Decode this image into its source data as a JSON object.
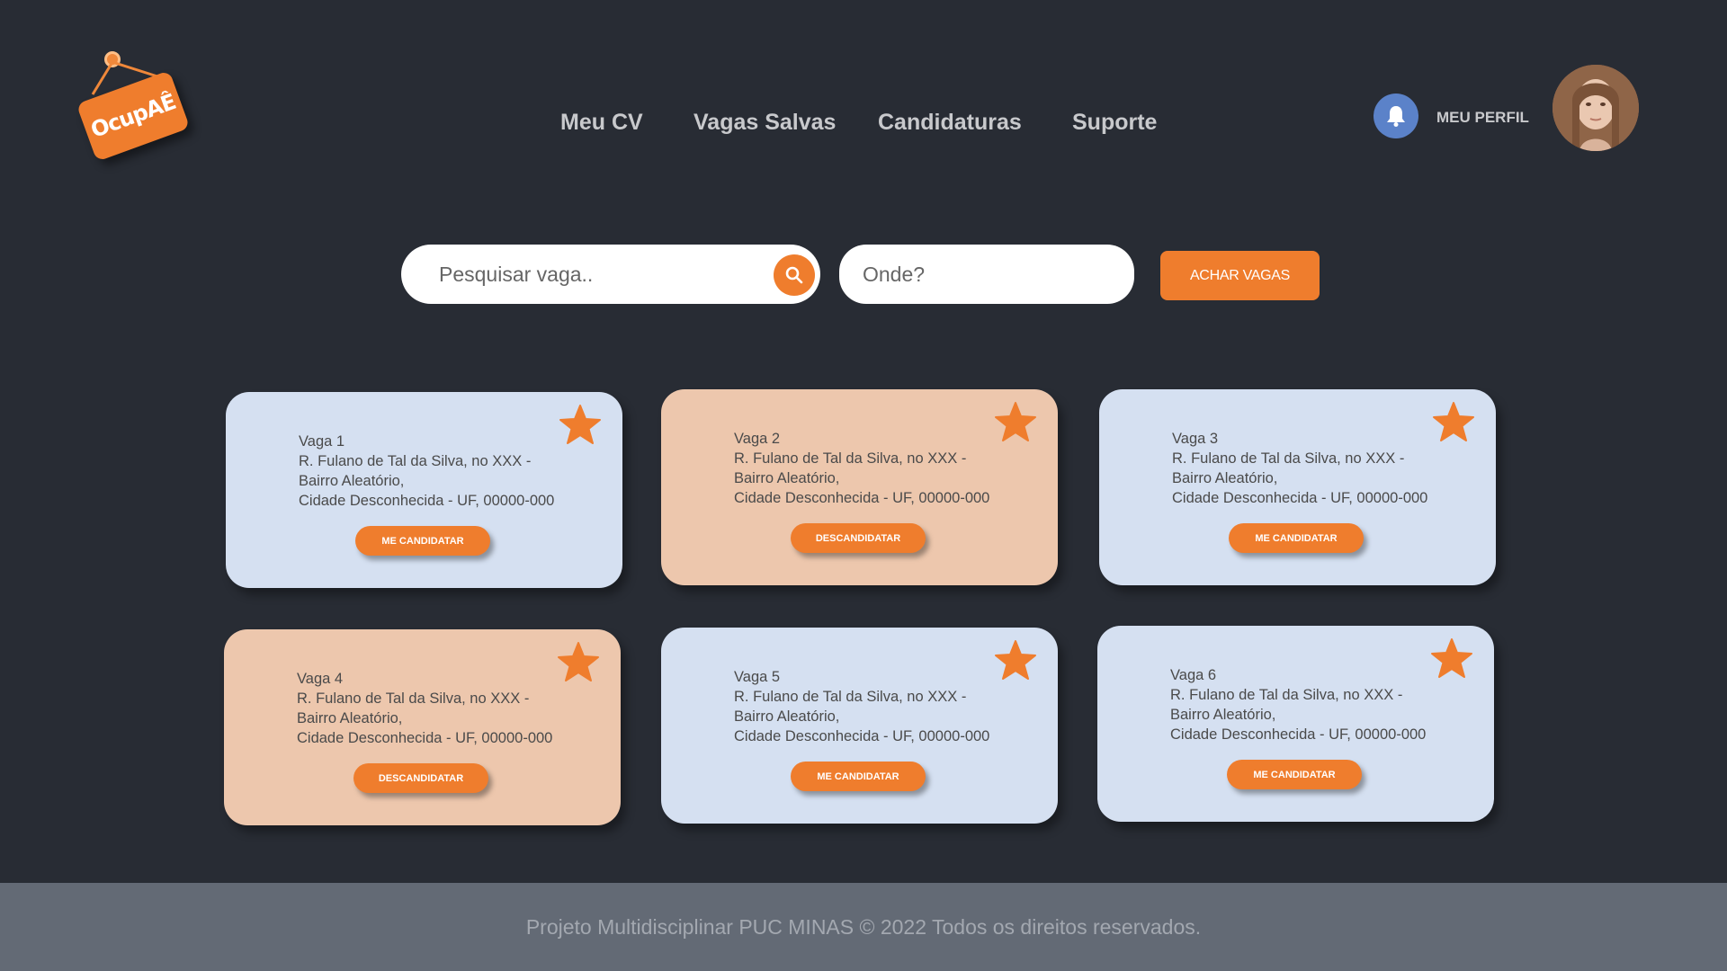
{
  "logo": {
    "text": "OcupAÊ"
  },
  "nav": {
    "items": [
      {
        "label": "Meu CV"
      },
      {
        "label": "Vagas Salvas"
      },
      {
        "label": "Candidaturas"
      },
      {
        "label": "Suporte"
      }
    ]
  },
  "header": {
    "notification_icon": "bell-icon",
    "profile_label": "MEU PERFIL"
  },
  "search": {
    "query_placeholder": "Pesquisar vaga..",
    "query_value": "",
    "location_placeholder": "Onde?",
    "location_value": "",
    "submit_label": "ACHAR VAGAS",
    "search_icon": "magnifier-icon"
  },
  "jobs": [
    {
      "title": "Vaga 1",
      "address1": "R. Fulano de Tal da Silva, no XXX -",
      "address2": "Bairro Aleatório,",
      "address3": "Cidade Desconhecida - UF, 00000-000",
      "action": "ME CANDIDATAR",
      "status": "open"
    },
    {
      "title": "Vaga 2",
      "address1": "R. Fulano de Tal da Silva, no XXX -",
      "address2": "Bairro Aleatório,",
      "address3": "Cidade Desconhecida - UF, 00000-000",
      "action": "DESCANDIDATAR",
      "status": "applied"
    },
    {
      "title": "Vaga 3",
      "address1": "R. Fulano de Tal da Silva, no XXX -",
      "address2": "Bairro Aleatório,",
      "address3": "Cidade Desconhecida - UF, 00000-000",
      "action": "ME CANDIDATAR",
      "status": "open"
    },
    {
      "title": "Vaga 4",
      "address1": "R. Fulano de Tal da Silva, no XXX -",
      "address2": "Bairro Aleatório,",
      "address3": "Cidade Desconhecida - UF, 00000-000",
      "action": "DESCANDIDATAR",
      "status": "applied"
    },
    {
      "title": "Vaga 5",
      "address1": "R. Fulano de Tal da Silva, no XXX -",
      "address2": "Bairro Aleatório,",
      "address3": "Cidade Desconhecida - UF, 00000-000",
      "action": "ME CANDIDATAR",
      "status": "open"
    },
    {
      "title": "Vaga 6",
      "address1": "R. Fulano de Tal da Silva, no XXX -",
      "address2": "Bairro Aleatório,",
      "address3": "Cidade Desconhecida - UF, 00000-000",
      "action": "ME CANDIDATAR",
      "status": "open"
    }
  ],
  "footer": {
    "text": "Projeto Multidisciplinar  PUC MINAS © 2022 Todos os direitos reservados."
  },
  "colors": {
    "background": "#282c34",
    "accent": "#ef7d2d",
    "card_open": "#d5e0f1",
    "card_applied": "#edc7ad",
    "footer": "#636a75",
    "bell": "#5b82c9"
  }
}
